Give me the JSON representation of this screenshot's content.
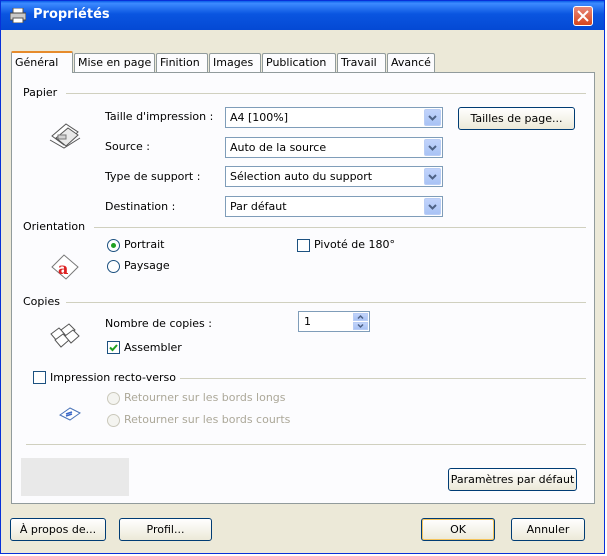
{
  "window": {
    "title": "Propriétés",
    "close_icon": "close-icon",
    "app_icon": "printer-icon"
  },
  "tabs": [
    {
      "label": "Général",
      "active": true
    },
    {
      "label": "Mise en page",
      "active": false
    },
    {
      "label": "Finition",
      "active": false
    },
    {
      "label": "Images",
      "active": false
    },
    {
      "label": "Publication",
      "active": false
    },
    {
      "label": "Travail",
      "active": false
    },
    {
      "label": "Avancé",
      "active": false
    }
  ],
  "paper": {
    "group_label": "Papier",
    "icon": "paper-stack-icon",
    "print_size_label": "Taille d'impression :",
    "print_size_value": "A4  [100%]",
    "page_sizes_button": "Tailles de page...",
    "source_label": "Source :",
    "source_value": "Auto de la source",
    "media_type_label": "Type de support :",
    "media_type_value": "Sélection auto du support",
    "destination_label": "Destination :",
    "destination_value": "Par défaut"
  },
  "orientation": {
    "group_label": "Orientation",
    "icon": "portrait-a-icon",
    "portrait_label": "Portrait",
    "landscape_label": "Paysage",
    "rotate_label": "Pivoté de 180°",
    "selected": "Portrait",
    "rotate_checked": false
  },
  "copies": {
    "group_label": "Copies",
    "icon": "collate-pages-icon",
    "count_label": "Nombre de copies :",
    "count_value": "1",
    "collate_label": "Assembler",
    "collate_checked": true
  },
  "duplex": {
    "label": "Impression recto-verso",
    "checked": false,
    "icon": "duplex-icon",
    "long_edge_label": "Retourner sur les bords longs",
    "short_edge_label": "Retourner sur les bords courts"
  },
  "defaults_button": "Paramètres par défaut",
  "footer": {
    "about_button": "À propos de...",
    "profile_button": "Profil...",
    "ok_button": "OK",
    "cancel_button": "Annuler"
  },
  "colors": {
    "titlebar": "#0a55e0",
    "dialog_bg": "#ece9d8",
    "tab_accent": "#e68b2c",
    "close_button": "#d5451c"
  }
}
